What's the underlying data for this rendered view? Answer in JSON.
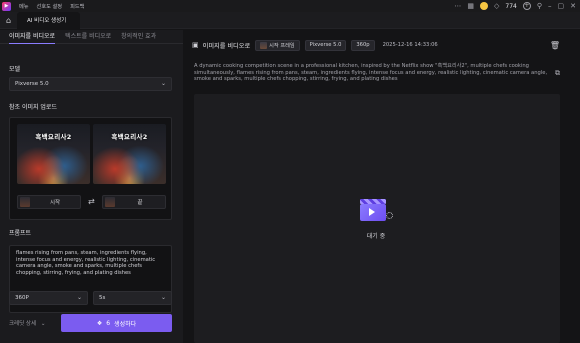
{
  "titlebar": {
    "logo": "app-logo",
    "menu": [
      "메뉴",
      "선호도 설정",
      "피드백"
    ],
    "credits": "774"
  },
  "tabbar": {
    "tab_label": "AI 비디오 생성기"
  },
  "left": {
    "mode_tabs": [
      "이미지를 비디오로",
      "텍스트를 비디오로",
      "창의적인 효과"
    ],
    "model_label": "모델",
    "model_value": "Pixverse 5.0",
    "ref_label": "참조 이미지 업로드",
    "thumb_title": "흑백요리사2",
    "start_label": "시작",
    "end_label": "끝",
    "prompt_label": "프롬프트",
    "prompt_text": "flames rising from pans, steam, ingredients flying, intense focus and energy, realistic lighting, cinematic camera angle, smoke and sparks, multiple chefs chopping, stirring, frying, and plating dishes",
    "resolution_value": "360P",
    "duration_value": "5s",
    "advanced_label": "크레딧 상세",
    "generate_count": "6",
    "generate_label": "생성하다"
  },
  "right": {
    "title": "이미지를 비디오로",
    "chip_mode": "시작 프레임",
    "chip_model": "Pixverse 5.0",
    "chip_res": "360p",
    "timestamp": "2025-12-16 14:33:06",
    "description": "A dynamic cooking competition scene in a professional kitchen, inspired by the Netflix show \"흑백요리사2\", multiple chefs cooking simultaneously, flames rising from pans, steam, ingredients flying, intense focus and energy, realistic lighting, cinematic camera angle, smoke and sparks, multiple chefs chopping, stirring, frying, and plating dishes",
    "status": "대기 중"
  },
  "colors": {
    "accent": "#7b5cf0",
    "background": "#141416",
    "panel": "#1b1b1e"
  }
}
